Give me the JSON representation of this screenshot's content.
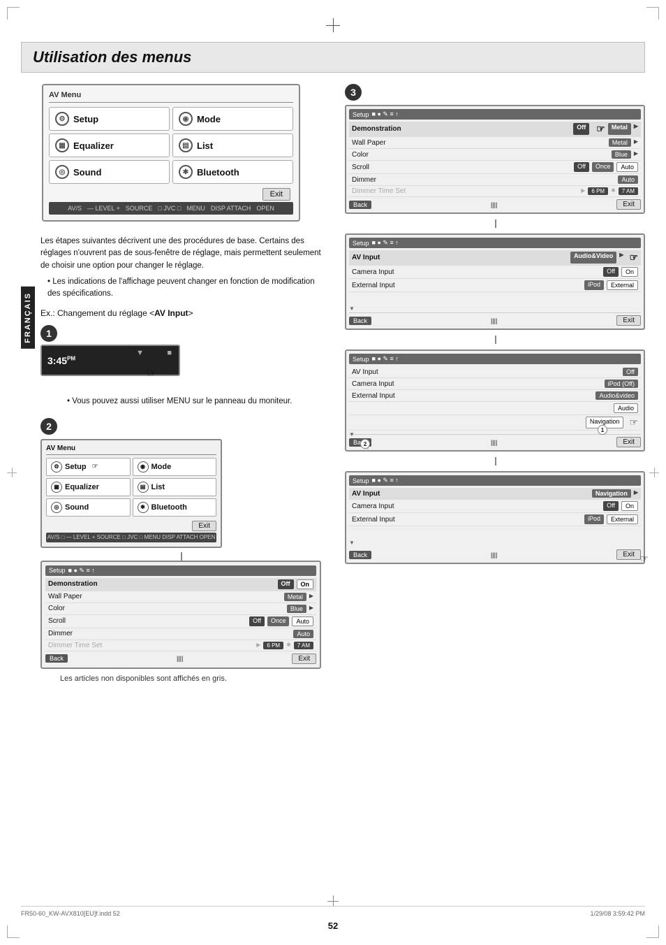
{
  "page": {
    "title": "Utilisation des menus",
    "page_number": "52",
    "footer_left": "FR50-60_KW-AVX810[EU]f.indd   52",
    "footer_right": "1/29/08   3:59:42 PM",
    "language_label": "FRANÇAIS"
  },
  "description": {
    "para1": "Les étapes suivantes décrivent une des procédures de base. Certains des réglages n'ouvrent pas de sous-fenêtre de réglage, mais permettent seulement de choisir une option pour changer le réglage.",
    "bullet1": "Les indications de l'affichage peuvent changer en fonction de modification des spécifications.",
    "ex_text": "Ex.: Changement du réglage <",
    "ex_bold": "AV Input",
    "ex_end": ">"
  },
  "av_menu": {
    "title": "AV Menu",
    "items": [
      {
        "icon": "⚙",
        "label": "Setup"
      },
      {
        "icon": "◉",
        "label": "Mode"
      },
      {
        "icon": "▦",
        "label": "Equalizer"
      },
      {
        "icon": "▤",
        "label": "List"
      },
      {
        "icon": "◎",
        "label": "Sound"
      },
      {
        "icon": "✱",
        "label": "Bluetooth"
      }
    ],
    "exit_label": "Exit"
  },
  "step1": {
    "number": "1",
    "time": "3:45",
    "time_sup": "PM",
    "bullet": "Vous pouvez aussi utiliser MENU sur le panneau du moniteur."
  },
  "step2": {
    "number": "2",
    "av_menu_title": "AV Menu",
    "items": [
      {
        "icon": "⚙",
        "label": "Setup"
      },
      {
        "icon": "◉",
        "label": "Mode"
      },
      {
        "icon": "▦",
        "label": "Equalizer"
      },
      {
        "icon": "▤",
        "label": "List"
      },
      {
        "icon": "◎",
        "label": "Sound"
      },
      {
        "icon": "✱",
        "label": "Bluetooth"
      }
    ],
    "exit_label": "Exit",
    "setup_rows": [
      {
        "label": "Demonstration",
        "values": [
          "Off",
          "On"
        ]
      },
      {
        "label": "Wall Paper",
        "values": [
          "Metal"
        ],
        "arrow": true
      },
      {
        "label": "Color",
        "values": [
          "Blue"
        ],
        "arrow": true
      },
      {
        "label": "Scroll",
        "values": [
          "Off",
          "Once",
          "Auto"
        ]
      },
      {
        "label": "Dimmer",
        "values": [
          "Auto"
        ]
      },
      {
        "label": "Dimmer Time Set",
        "values": [
          "6 PM",
          "7 AM"
        ],
        "arrow": true
      }
    ],
    "back_label": "Back",
    "exit_label2": "Exit",
    "non_disponibles": "Les articles non disponibles sont affichés en gris."
  },
  "step3": {
    "number": "3",
    "screens": [
      {
        "title": "Setup",
        "rows": [
          {
            "label": "Demonstration",
            "values": [
              "Off"
            ],
            "extra": "Metal",
            "arrow": true
          },
          {
            "label": "Wall Paper",
            "values": [
              "Metal"
            ],
            "arrow": true
          },
          {
            "label": "Color",
            "values": [
              "Blue"
            ],
            "arrow": true
          },
          {
            "label": "Scroll",
            "values": [
              "Off",
              "Once",
              "Auto"
            ]
          },
          {
            "label": "Dimmer",
            "values": [
              "Auto"
            ]
          },
          {
            "label": "Dimmer Time Set",
            "values": [
              "6 PM",
              "7 AM"
            ],
            "arrow": true
          }
        ],
        "back": "Back",
        "exit": "Exit"
      },
      {
        "title": "Setup",
        "header": "AV Input",
        "rows": [
          {
            "label": "AV Input",
            "values": [
              "Audio&Video"
            ],
            "arrow": true
          },
          {
            "label": "Camera Input",
            "values": [
              "Off",
              "On"
            ]
          },
          {
            "label": "External Input",
            "values": [
              "iPod",
              "External"
            ]
          }
        ],
        "back": "Back",
        "exit": "Exit"
      },
      {
        "title": "Setup",
        "header": "AV Input",
        "rows": [
          {
            "label": "AV Input",
            "values": [
              "Off"
            ]
          },
          {
            "label": "Camera Input",
            "values": [
              "iPod (Off)"
            ]
          },
          {
            "label": "External Input",
            "values": [
              "Audio&video"
            ]
          },
          {
            "label": "",
            "values": [
              "Audio"
            ]
          },
          {
            "label": "",
            "values": [
              "Navigation"
            ]
          }
        ],
        "back": "Back",
        "exit": "Exit",
        "cursors": [
          "1",
          "2"
        ]
      },
      {
        "title": "Setup",
        "header": "AV Input",
        "rows": [
          {
            "label": "AV Input",
            "values": [
              "Navigation"
            ],
            "arrow": true
          },
          {
            "label": "Camera Input",
            "values": [
              "Off",
              "On"
            ]
          },
          {
            "label": "External Input",
            "values": [
              "iPod",
              "External"
            ]
          }
        ],
        "back": "Back",
        "exit": "Exit"
      }
    ]
  }
}
